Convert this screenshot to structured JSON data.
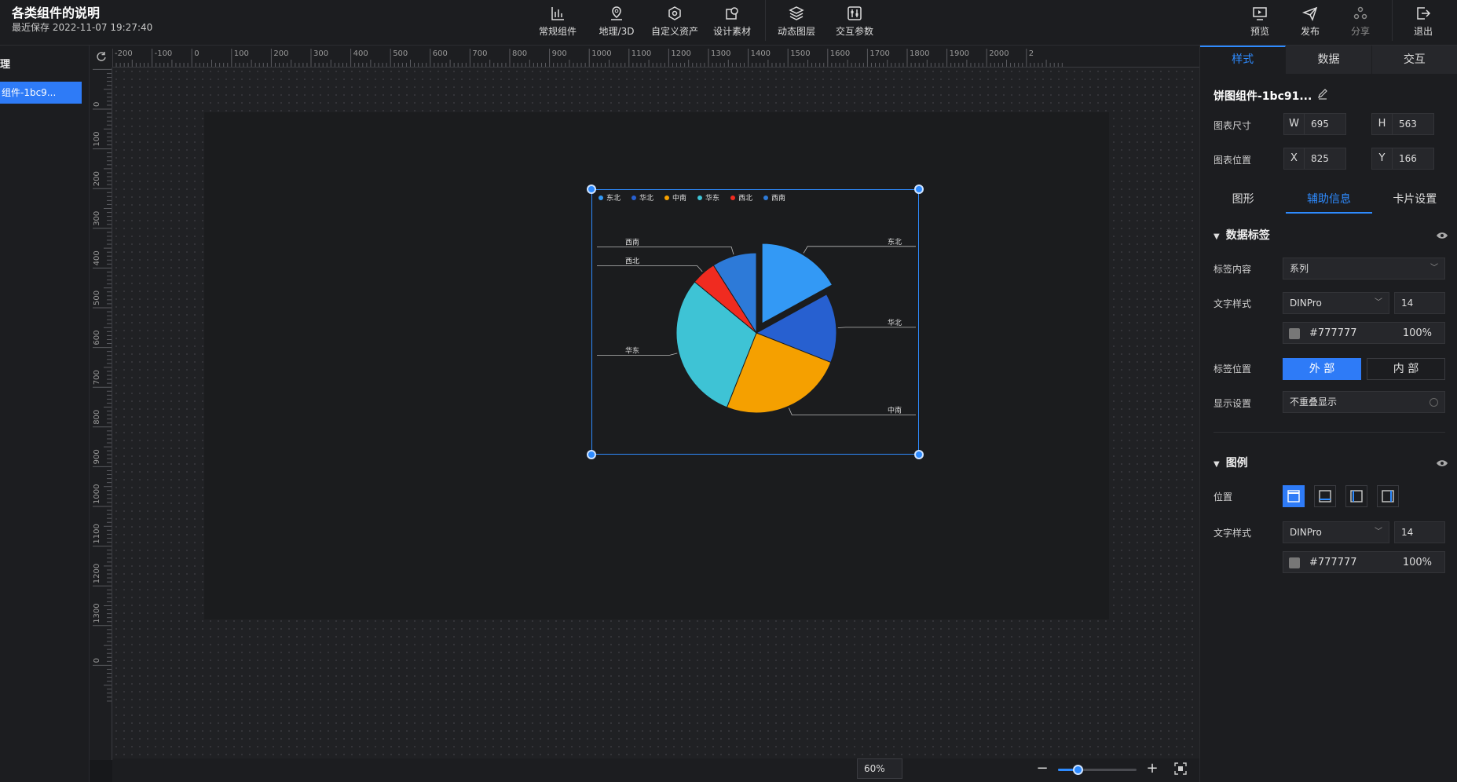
{
  "header": {
    "title": "各类组件的说明",
    "save_time": "最近保存 2022-11-07 19:27:40",
    "tools": [
      {
        "label": "常规组件",
        "icon": "bar-chart-icon"
      },
      {
        "label": "地理/3D",
        "icon": "map-pin-icon"
      },
      {
        "label": "自定义资产",
        "icon": "hexagon-icon"
      },
      {
        "label": "设计素材",
        "icon": "material-icon"
      },
      {
        "label": "动态图层",
        "icon": "layers-icon"
      },
      {
        "label": "交互参数",
        "icon": "params-icon"
      }
    ],
    "actions": [
      {
        "label": "预览",
        "icon": "preview-icon"
      },
      {
        "label": "发布",
        "icon": "send-icon"
      },
      {
        "label": "分享",
        "icon": "share-icon",
        "disabled": true
      },
      {
        "label": "退出",
        "icon": "exit-icon"
      }
    ]
  },
  "left_panel": {
    "heading": "理",
    "layer_item": "组件-1bc9..."
  },
  "rulers": {
    "top_ticks": [
      "-200",
      "-100",
      "0",
      "100",
      "200",
      "300",
      "400",
      "500",
      "600",
      "700",
      "800",
      "900",
      "1000",
      "1100",
      "1200",
      "1300",
      "1400",
      "1500",
      "1600",
      "1700",
      "1800",
      "1900",
      "2000",
      "2"
    ],
    "left_ticks": [
      "0",
      "100",
      "200",
      "300",
      "400",
      "500",
      "600",
      "700",
      "800",
      "900",
      "1000",
      "1100",
      "1200",
      "1300",
      "0"
    ]
  },
  "chart_data": {
    "type": "pie",
    "title": "",
    "legend_position": "top",
    "series": [
      {
        "name": "东北",
        "value": 17,
        "color": "#3399f5",
        "exploded": true
      },
      {
        "name": "华北",
        "value": 14,
        "color": "#2760d0"
      },
      {
        "name": "中南",
        "value": 25,
        "color": "#f5a000"
      },
      {
        "name": "华东",
        "value": 30,
        "color": "#3ec3d5"
      },
      {
        "name": "西北",
        "value": 5,
        "color": "#f02b20"
      },
      {
        "name": "西南",
        "value": 9,
        "color": "#2d7ad8"
      }
    ]
  },
  "zoom": {
    "level_label": "60%",
    "value": 0.25,
    "minus": "−",
    "plus": "+"
  },
  "right_panel": {
    "tabs": [
      "样式",
      "数据",
      "交互"
    ],
    "component_name": "饼图组件-1bc91...",
    "size_label": "图表尺寸",
    "width_prefix": "W",
    "width": "695",
    "height_prefix": "H",
    "height": "563",
    "position_label": "图表位置",
    "x_prefix": "X",
    "x": "825",
    "y_prefix": "Y",
    "y": "166",
    "subtabs": [
      "图形",
      "辅助信息",
      "卡片设置"
    ],
    "data_label_section": {
      "title": "数据标签",
      "content_label": "标签内容",
      "content_value": "系列",
      "text_style_label": "文字样式",
      "font": "DINPro",
      "font_size": "14",
      "color_hex": "#777777",
      "opacity": "100%",
      "position_label": "标签位置",
      "position_outside": "外 部",
      "position_inside": "内 部",
      "display_label": "显示设置",
      "display_value": "不重叠显示"
    },
    "legend_section": {
      "title": "图例",
      "position_label": "位置",
      "text_style_label": "文字样式",
      "font": "DINPro",
      "font_size": "14",
      "color_hex": "#777777",
      "opacity": "100%"
    }
  }
}
